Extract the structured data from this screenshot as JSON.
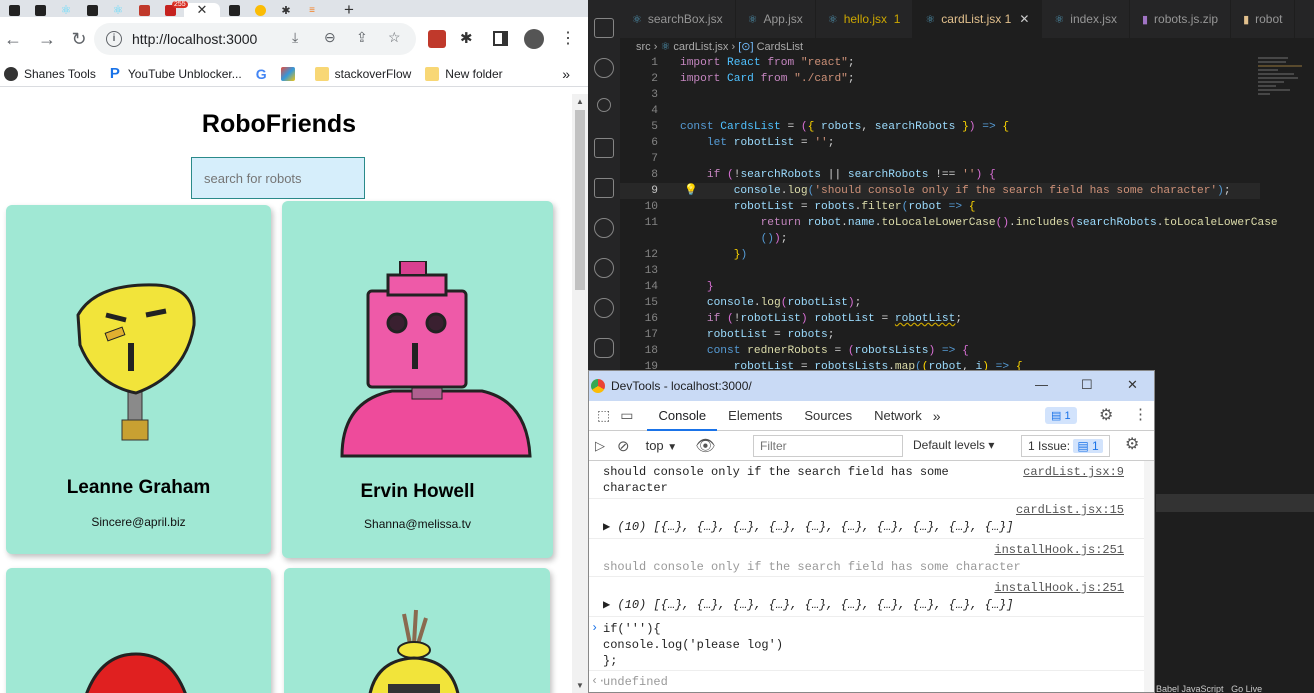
{
  "browser": {
    "tab_badge": "255",
    "url": "http://localhost:3000",
    "bookmarks": [
      {
        "label": "Shanes Tools"
      },
      {
        "label": "YouTube Unblocker..."
      },
      {
        "label": ""
      },
      {
        "label": ""
      },
      {
        "label": "stackoverFlow"
      },
      {
        "label": "New folder"
      }
    ],
    "more": "»",
    "colors": {
      "card": "#a0e8d4",
      "search_bg": "#d6eefb",
      "tabstrip": "#dfe3e8"
    }
  },
  "app": {
    "title": "RoboFriends",
    "search_placeholder": "search for robots",
    "cards": [
      {
        "name": "Leanne Graham",
        "email": "Sincere@april.biz"
      },
      {
        "name": "Ervin Howell",
        "email": "Shanna@melissa.tv"
      },
      {
        "name": "",
        "email": ""
      },
      {
        "name": "",
        "email": ""
      }
    ]
  },
  "vscode": {
    "tabs": [
      {
        "label": "searchBox.jsx",
        "badge": ""
      },
      {
        "label": "App.jsx",
        "badge": ""
      },
      {
        "label": "hello.jsx",
        "badge": "1"
      },
      {
        "label": "cardList.jsx",
        "badge": "1"
      },
      {
        "label": "index.jsx",
        "badge": ""
      },
      {
        "label": "robots.js.zip",
        "badge": ""
      },
      {
        "label": "robot",
        "badge": ""
      }
    ],
    "breadcrumb": {
      "folder": "src",
      "file": "cardList.jsx",
      "symbol": "CardsList"
    },
    "line_numbers": [
      "1",
      "2",
      "3",
      "4",
      "5",
      "6",
      "7",
      "8",
      "9",
      "10",
      "11",
      "",
      "12",
      "13",
      "14",
      "15",
      "16",
      "17",
      "18",
      "19"
    ],
    "status": {
      "language": "Babel JavaScript",
      "golive": "Go Live"
    }
  },
  "devtools": {
    "title": "DevTools - localhost:3000/",
    "tabs": [
      "Console",
      "Elements",
      "Sources",
      "Network"
    ],
    "more_tabs": "»",
    "messages_count": "1",
    "context": "top",
    "filter_placeholder": "Filter",
    "levels": "Default levels ▾",
    "issues_label": "1 Issue:",
    "issues_count": "1",
    "log": [
      {
        "source": "cardList.jsx:9",
        "lines": [
          "should console only if the search field has some",
          "character"
        ]
      },
      {
        "source": "cardList.jsx:15",
        "lines": [
          "▶ (10) [{…}, {…}, {…}, {…}, {…}, {…}, {…}, {…}, {…}, {…}]"
        ]
      },
      {
        "source": "installHook.js:251",
        "lines": [
          "should console only if the search field has some character"
        ]
      },
      {
        "source": "installHook.js:251",
        "lines": [
          "▶ (10) [{…}, {…}, {…}, {…}, {…}, {…}, {…}, {…}, {…}, {…}]"
        ]
      },
      {
        "source": "",
        "lines": [
          "if('''){",
          "console.log('please log')",
          "};"
        ]
      },
      {
        "source": "",
        "lines": [
          "undefined"
        ]
      }
    ]
  }
}
